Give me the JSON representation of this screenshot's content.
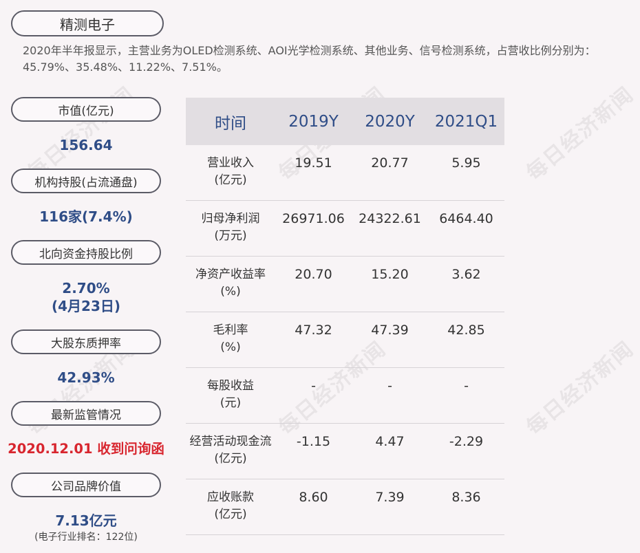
{
  "title": "精测电子",
  "summary": "2020年半年报显示，主营业务为OLED检测系统、AOI光学检测系统、其他业务、信号检测系统，占营收比例分别为：45.79%、35.48%、11.22%、7.51%。",
  "watermark": "每日经济新闻",
  "left_panel": {
    "market_value_label": "市值(亿元)",
    "market_value": "156.64",
    "institution_label": "机构持股(占流通盘)",
    "institution_value": "116家(7.4%)",
    "northbound_label": "北向资金持股比例",
    "northbound_value": "2.70%",
    "northbound_date": "(4月23日)",
    "pledge_label": "大股东质押率",
    "pledge_value": "42.93%",
    "regulation_label": "最新监管情况",
    "regulation_value": "2020.12.01 收到问询函",
    "brand_label": "公司品牌价值",
    "brand_value": "7.13亿元",
    "brand_note": "(电子行业排名：122位)"
  },
  "table": {
    "headers": [
      "时间",
      "2019Y",
      "2020Y",
      "2021Q1"
    ],
    "rows": [
      {
        "label": "营业收入",
        "unit": "(亿元)",
        "values": [
          "19.51",
          "20.77",
          "5.95"
        ]
      },
      {
        "label": "归母净利润",
        "unit": "(万元)",
        "values": [
          "26971.06",
          "24322.61",
          "6464.40"
        ]
      },
      {
        "label": "净资产收益率",
        "unit": "(%)",
        "values": [
          "20.70",
          "15.20",
          "3.62"
        ]
      },
      {
        "label": "毛利率",
        "unit": "(%)",
        "values": [
          "47.32",
          "47.39",
          "42.85"
        ]
      },
      {
        "label": "每股收益",
        "unit": "(元)",
        "values": [
          "-",
          "-",
          "-"
        ]
      },
      {
        "label": "经营活动现金流",
        "unit": "(亿元)",
        "values": [
          "-1.15",
          "4.47",
          "-2.29"
        ]
      },
      {
        "label": "应收账款",
        "unit": "(亿元)",
        "values": [
          "8.60",
          "7.39",
          "8.36"
        ]
      }
    ]
  },
  "colors": {
    "accent_blue": "#2f4d87",
    "alert_red": "#d8262f",
    "header_bg": "#e2dee2"
  }
}
